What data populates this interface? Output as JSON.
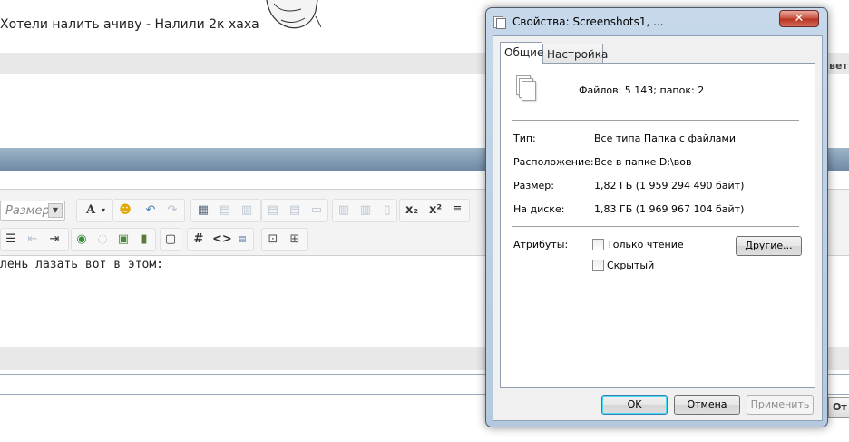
{
  "background": {
    "post_text": "Хотели налить ачиву - Налили 2к хаха",
    "header_right_label": "вет",
    "font_size_placeholder": "Размер",
    "editor_text": "лень лазать вот в этом:",
    "side_button_label": "От"
  },
  "dialog": {
    "title": "Свойства: Screenshots1, ...",
    "close_symbol": "✕",
    "tabs": [
      {
        "label": "Общие",
        "active": true
      },
      {
        "label": "Настройка",
        "active": false
      }
    ],
    "general": {
      "files_summary": "Файлов: 5 143; папок: 2",
      "type_label": "Тип:",
      "type_value": "Все типа Папка с файлами",
      "location_label": "Расположение:",
      "location_value": "Все в папке D:\\вов",
      "size_label": "Размер:",
      "size_value": "1,82 ГБ (1 959 294 490 байт)",
      "disk_label": "На диске:",
      "disk_value": "1,83 ГБ (1 969 967 104 байт)",
      "attributes_label": "Атрибуты:",
      "readonly_label": "Только чтение",
      "readonly_checked": false,
      "hidden_label": "Скрытый",
      "hidden_checked": false,
      "other_button": "Другие..."
    },
    "buttons": {
      "ok": "OK",
      "cancel": "Отмена",
      "apply": "Применить"
    }
  }
}
